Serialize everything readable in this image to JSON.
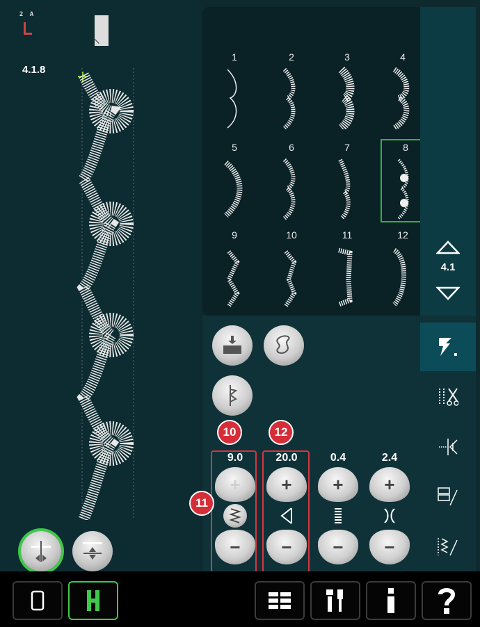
{
  "preview": {
    "stitch_number": "4.1.8",
    "foot_label": "2 A"
  },
  "stitch_menu": {
    "cells": [
      {
        "num": "1"
      },
      {
        "num": "2"
      },
      {
        "num": "3"
      },
      {
        "num": "4"
      },
      {
        "num": "5"
      },
      {
        "num": "6"
      },
      {
        "num": "7"
      },
      {
        "num": "8"
      },
      {
        "num": "9"
      },
      {
        "num": "10"
      },
      {
        "num": "11"
      },
      {
        "num": "12"
      }
    ],
    "selected": "8",
    "menu_label": "4.1"
  },
  "params": [
    {
      "value": "9.0",
      "icon": "stitch-width-icon"
    },
    {
      "value": "20.0",
      "icon": "stitch-length-icon"
    },
    {
      "value": "0.4",
      "icon": "density-icon"
    },
    {
      "value": "2.4",
      "icon": "tension-icon"
    }
  ],
  "callouts": [
    "10",
    "11",
    "12"
  ],
  "colors": {
    "accent_green": "#3fc84b",
    "callout_red": "#d62d39",
    "panel": "#0a2126"
  }
}
